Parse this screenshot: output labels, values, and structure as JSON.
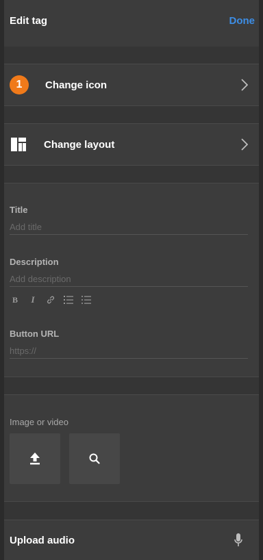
{
  "header": {
    "title": "Edit tag",
    "done_label": "Done"
  },
  "rows": {
    "change_icon": {
      "badge": "1",
      "label": "Change icon"
    },
    "change_layout": {
      "label": "Change layout"
    }
  },
  "form": {
    "title": {
      "label": "Title",
      "placeholder": "Add title"
    },
    "description": {
      "label": "Description",
      "placeholder": "Add description"
    },
    "button_url": {
      "label": "Button URL",
      "placeholder": "https://"
    }
  },
  "media": {
    "label": "Image or video"
  },
  "audio": {
    "label": "Upload audio"
  },
  "colors": {
    "accent_blue": "#3d8ee6",
    "badge_orange": "#f07a1a",
    "panel_bg": "#3c3c3c"
  },
  "icons": {
    "chevron": "chevron-right-icon",
    "layout": "layout-grid-icon",
    "upload": "upload-icon",
    "search": "search-icon",
    "microphone": "microphone-icon"
  }
}
